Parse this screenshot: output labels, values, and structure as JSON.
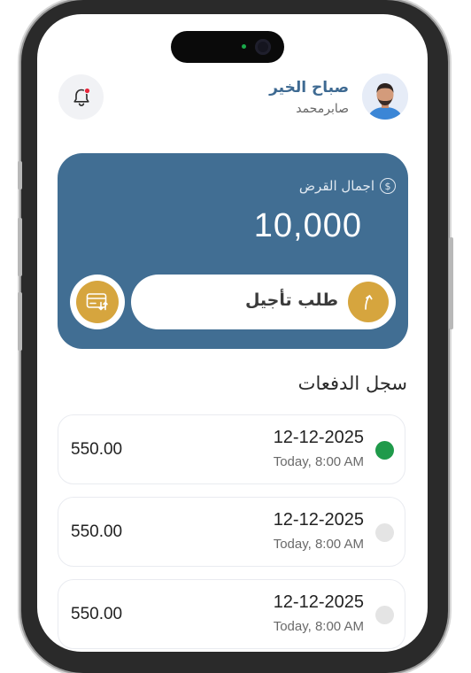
{
  "header": {
    "greeting": "صباح الخير",
    "user_name": "صابرمحمد"
  },
  "loan": {
    "label": "اجمال القرض",
    "amount": "10,000",
    "currency_icon": "$",
    "postpone_label": "طلب تأجيل"
  },
  "history": {
    "title": "سجل الدفعات",
    "rows": [
      {
        "date": "12-12-2025",
        "time": "Today, 8:00 AM",
        "amount": "550.00",
        "status": "paid"
      },
      {
        "date": "12-12-2025",
        "time": "Today, 8:00 AM",
        "amount": "550.00",
        "status": "pending"
      },
      {
        "date": "12-12-2025",
        "time": "Today, 8:00 AM",
        "amount": "550.00",
        "status": "pending"
      }
    ]
  },
  "colors": {
    "card": "#416e93",
    "accent_gold": "#d6a53e",
    "greeting": "#3e6a92",
    "paid": "#1f9a4a",
    "pending": "#e4e4e4",
    "notification_dot": "#e8263b"
  }
}
